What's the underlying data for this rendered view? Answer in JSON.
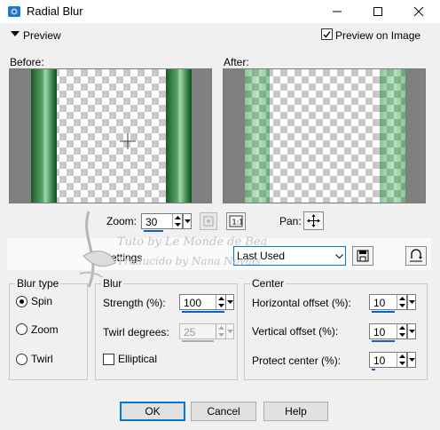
{
  "window": {
    "title": "Radial Blur",
    "icon": "app-icon",
    "controls": [
      "minimize-icon",
      "maximize-icon",
      "close-icon"
    ]
  },
  "preview": {
    "toggle_label": "Preview",
    "preview_on_image_label": "Preview on Image",
    "preview_on_image_checked": true,
    "before_label": "Before:",
    "after_label": "After:"
  },
  "zoom": {
    "label": "Zoom:",
    "value": "30",
    "pan_label": "Pan:"
  },
  "settings": {
    "label": "Settings",
    "selected": "Last Used"
  },
  "watermark": {
    "line1": "Tuto by Le Monde de Bea",
    "line2": "Traducido by Nana Novais"
  },
  "blur_type": {
    "title": "Blur type",
    "options": [
      "Spin",
      "Zoom",
      "Twirl"
    ],
    "selected": "Spin"
  },
  "blur": {
    "title": "Blur",
    "strength_label": "Strength (%):",
    "strength_value": "100",
    "twirl_label": "Twirl degrees:",
    "twirl_value": "25",
    "elliptical_label": "Elliptical",
    "elliptical_checked": false
  },
  "center": {
    "title": "Center",
    "horizontal_label": "Horizontal offset (%):",
    "horizontal_value": "10",
    "vertical_label": "Vertical offset (%):",
    "vertical_value": "10",
    "protect_label": "Protect center (%):",
    "protect_value": "10"
  },
  "buttons": {
    "ok": "OK",
    "cancel": "Cancel",
    "help": "Help"
  },
  "colors": {
    "accent": "#0078d7",
    "spin_bar": "#0a64c8",
    "green_dark": "#1e5a2c",
    "green_light": "#a5d7ad"
  }
}
